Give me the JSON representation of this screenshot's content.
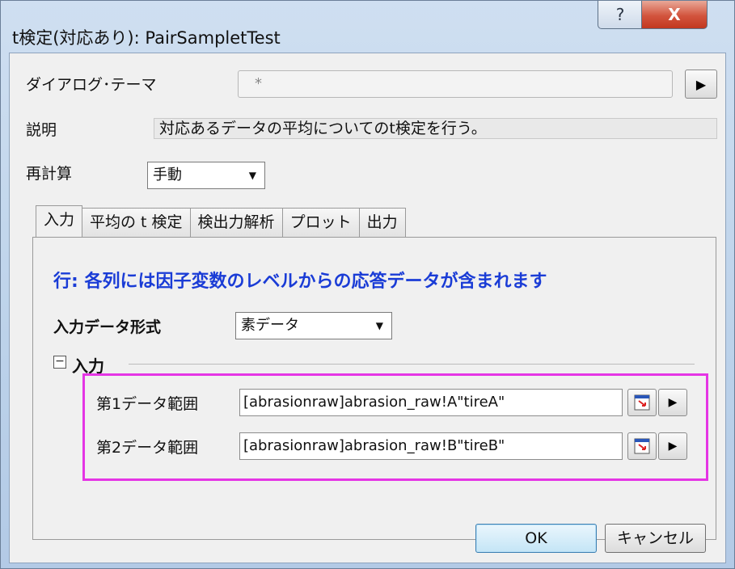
{
  "window": {
    "title": "t検定(対応あり): PairSampletTest",
    "help_label": "?",
    "close_label": "X"
  },
  "theme": {
    "label": "ダイアログ･テーマ",
    "value": "*"
  },
  "description": {
    "label": "説明",
    "text": "対応あるデータの平均についてのt検定を行う。"
  },
  "recalc": {
    "label": "再計算",
    "value": "手動"
  },
  "tabs": [
    {
      "label": "入力",
      "active": true
    },
    {
      "label": "平均の t 検定",
      "active": false
    },
    {
      "label": "検出力解析",
      "active": false
    },
    {
      "label": "プロット",
      "active": false
    },
    {
      "label": "出力",
      "active": false
    }
  ],
  "input_panel": {
    "heading": "行: 各列には因子変数のレベルからの応答データが含まれます",
    "format_label": "入力データ形式",
    "format_value": "素データ",
    "group_label": "入力",
    "group_toggle": "−",
    "ranges": [
      {
        "label": "第1データ範囲",
        "value": "[abrasionraw]abrasion_raw!A\"tireA\""
      },
      {
        "label": "第2データ範囲",
        "value": "[abrasionraw]abrasion_raw!B\"tireB\""
      }
    ]
  },
  "buttons": {
    "ok": "OK",
    "cancel": "キャンセル"
  },
  "colors": {
    "heading": "#1a3cd6",
    "highlight": "#e535e5",
    "close": "#c2371f"
  }
}
